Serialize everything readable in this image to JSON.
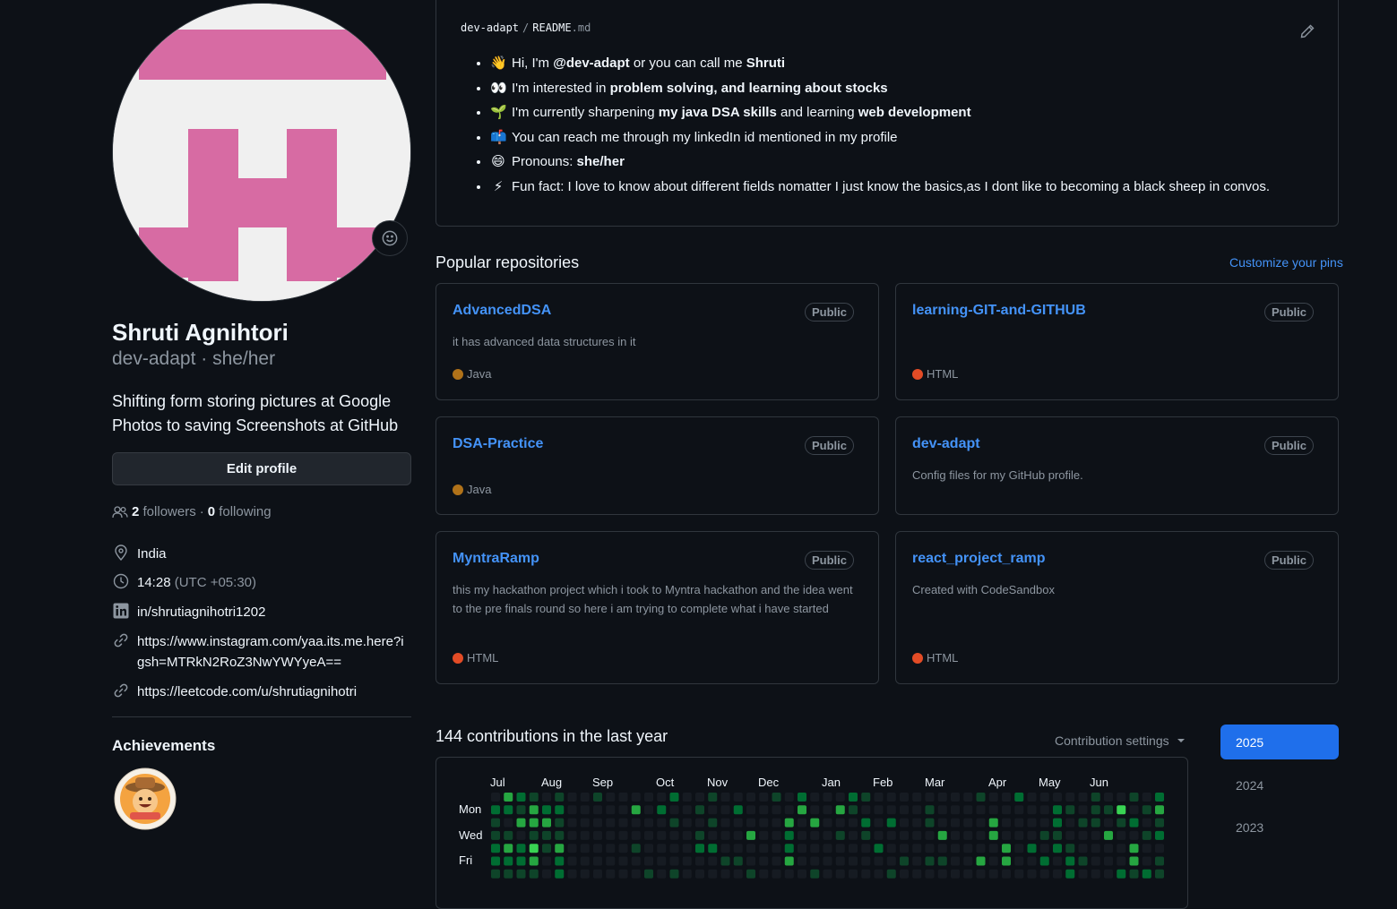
{
  "profile": {
    "fullname": "Shruti Agnihtori",
    "username_line": "dev-adapt · she/her",
    "bio": "Shifting form storing pictures at Google Photos to saving Screenshots at GitHub",
    "edit_label": "Edit profile",
    "followers_count": "2",
    "followers_label": "followers",
    "separator": "·",
    "following_count": "0",
    "following_label": "following",
    "location": "India",
    "local_time": "14:28",
    "timezone": "(UTC +05:30)",
    "linkedin": "in/shrutiagnihotri1202",
    "instagram": "https://www.instagram.com/yaa.its.me.here?igsh=MTRkN2RoZ3NwYWYyeA==",
    "leetcode": "https://leetcode.com/u/shrutiagnihotri",
    "achievements_title": "Achievements"
  },
  "readme": {
    "owner": "dev-adapt",
    "sep": "/",
    "file": "README",
    "ext": ".md",
    "items": [
      {
        "emoji": "👋",
        "pre": "Hi, I'm ",
        "b1": "@dev-adapt",
        "mid": " or you can call me ",
        "b2": "Shruti",
        "post": ""
      },
      {
        "emoji": "👀",
        "pre": "I'm interested in ",
        "b1": "problem solving, and learning about stocks",
        "mid": "",
        "b2": "",
        "post": ""
      },
      {
        "emoji": "🌱",
        "pre": "I'm currently sharpening ",
        "b1": "my java DSA skills",
        "mid": " and learning ",
        "b2": "web development",
        "post": ""
      },
      {
        "emoji": "📫",
        "pre": "You can reach me through my linkedIn id mentioned in my profile",
        "b1": "",
        "mid": "",
        "b2": "",
        "post": ""
      },
      {
        "emoji": "😄",
        "pre": "Pronouns: ",
        "b1": "she/her",
        "mid": "",
        "b2": "",
        "post": ""
      },
      {
        "emoji": "⚡",
        "pre": "Fun fact: I love to know about different fields nomatter I just know the basics,as I dont like to becoming a black sheep in convos.",
        "b1": "",
        "mid": "",
        "b2": "",
        "post": ""
      }
    ]
  },
  "popular": {
    "title": "Popular repositories",
    "customize": "Customize your pins",
    "repos": [
      {
        "name": "AdvancedDSA",
        "visibility": "Public",
        "desc": "it has advanced data structures in it",
        "lang": "Java",
        "color": "#b07219"
      },
      {
        "name": "learning-GIT-and-GITHUB",
        "visibility": "Public",
        "desc": "",
        "lang": "HTML",
        "color": "#e34c26"
      },
      {
        "name": "DSA-Practice",
        "visibility": "Public",
        "desc": "",
        "lang": "Java",
        "color": "#b07219"
      },
      {
        "name": "dev-adapt",
        "visibility": "Public",
        "desc": "Config files for my GitHub profile.",
        "lang": "",
        "color": ""
      },
      {
        "name": "MyntraRamp",
        "visibility": "Public",
        "desc": "this my hackathon project which i took to Myntra hackathon and the idea went to the pre finals round so here i am trying to complete what i have started",
        "lang": "HTML",
        "color": "#e34c26"
      },
      {
        "name": "react_project_ramp",
        "visibility": "Public",
        "desc": "Created with CodeSandbox",
        "lang": "HTML",
        "color": "#e34c26"
      }
    ]
  },
  "contributions": {
    "title": "144 contributions in the last year",
    "settings": "Contribution settings",
    "months": [
      "Jul",
      "Aug",
      "Sep",
      "Oct",
      "Nov",
      "Dec",
      "Jan",
      "Feb",
      "Mar",
      "Apr",
      "May",
      "Jun"
    ],
    "days": [
      "Mon",
      "Wed",
      "Fri"
    ],
    "years": [
      "2025",
      "2024",
      "2023"
    ],
    "levels_colors": [
      "#161b22",
      "#0e4429",
      "#006d32",
      "#26a641",
      "#39d353"
    ]
  }
}
